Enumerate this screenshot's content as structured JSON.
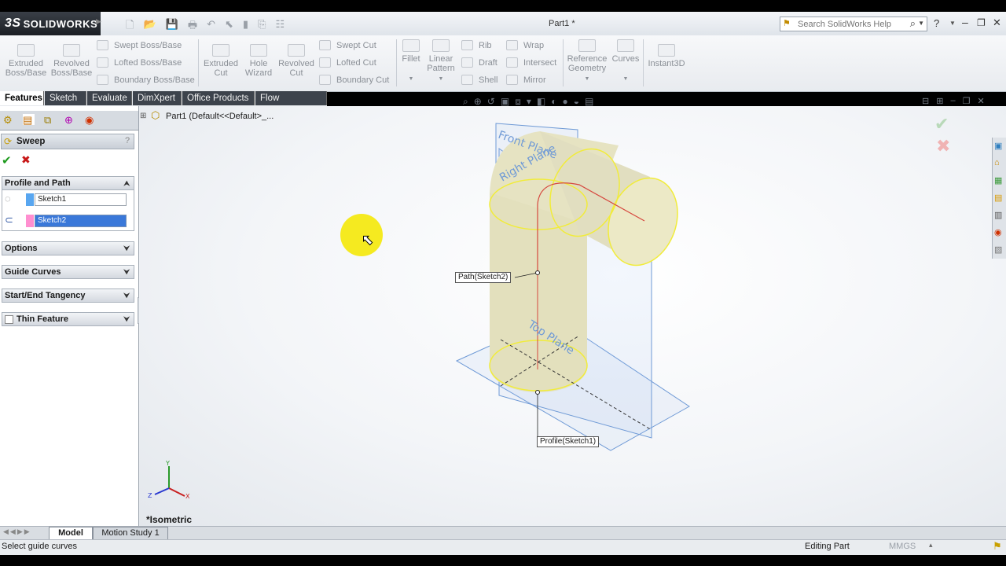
{
  "app": {
    "brand": "SOLIDWORKS",
    "brand_prefix": "3S",
    "doc_title": "Part1 *"
  },
  "search": {
    "placeholder": "Search SolidWorks Help"
  },
  "ribbon": {
    "features_large": [
      {
        "label": "Extruded Boss/Base"
      },
      {
        "label": "Revolved Boss/Base"
      }
    ],
    "features_small": [
      "Swept Boss/Base",
      "Lofted Boss/Base",
      "Boundary Boss/Base"
    ],
    "cut_large": [
      {
        "label": "Extruded Cut"
      },
      {
        "label": "Hole Wizard"
      },
      {
        "label": "Revolved Cut"
      }
    ],
    "cut_small": [
      "Swept Cut",
      "Lofted Cut",
      "Boundary Cut"
    ],
    "misc_large": [
      {
        "label": "Fillet"
      },
      {
        "label": "Linear Pattern"
      }
    ],
    "misc_small_a": [
      "Rib",
      "Draft",
      "Shell"
    ],
    "misc_small_b": [
      "Wrap",
      "Intersect",
      "Mirror"
    ],
    "right_large": [
      {
        "label": "Reference Geometry"
      },
      {
        "label": "Curves"
      },
      {
        "label": "Instant3D"
      }
    ]
  },
  "tabs": [
    "Features",
    "Sketch",
    "Evaluate",
    "DimXpert",
    "Office Products",
    "Flow Simulation"
  ],
  "property_manager": {
    "title": "Sweep",
    "help": "?",
    "ok_label": "✔",
    "cancel_label": "✖",
    "profile_path_title": "Profile and Path",
    "profile_value": "Sketch1",
    "path_value": "Sketch2",
    "sections": [
      "Options",
      "Guide Curves",
      "Start/End Tangency",
      "Thin Feature"
    ]
  },
  "feature_tree": {
    "root": "Part1  (Default<<Default>_..."
  },
  "viewport": {
    "callout_path": "Path(Sketch2)",
    "callout_profile": "Profile(Sketch1)",
    "plane_front": "Front Plane",
    "plane_right": "Right Plane",
    "plane_top": "Top Plane",
    "view_name": "*Isometric",
    "triad": {
      "x": "X",
      "y": "Y",
      "z": "Z"
    }
  },
  "bottom_tabs": [
    "Model",
    "Motion Study 1"
  ],
  "status": {
    "message": "Select guide curves",
    "mode": "Editing Part",
    "units": "MMGS"
  },
  "colors": {
    "accent": "#f5d400",
    "selection": "#3a78d9",
    "plane": "#6f9ad6"
  }
}
